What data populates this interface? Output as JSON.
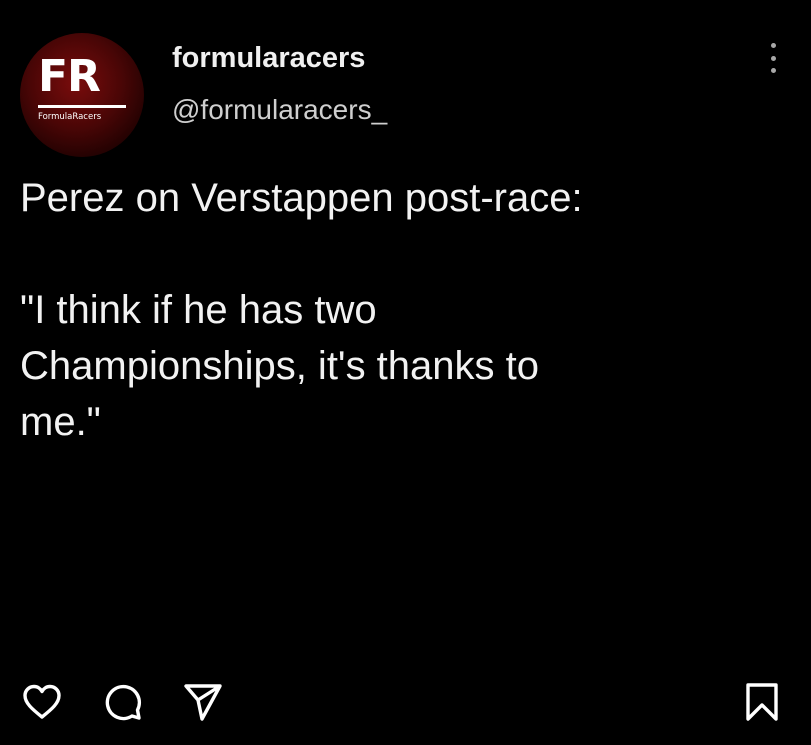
{
  "profile": {
    "avatar_logo": "FR",
    "avatar_subtext": "FormulaRacers",
    "username": "formularacers",
    "handle": "@formularacers_",
    "brand_color": "#6b0a0a"
  },
  "post": {
    "text": "Perez on Verstappen post-race:\n\n\"I think if he has two\nChampionships, it's thanks to\nme.\""
  },
  "actions": {
    "like_icon": "heart-icon",
    "comment_icon": "comment-icon",
    "share_icon": "send-icon",
    "save_icon": "bookmark-icon",
    "more_icon": "more-vertical-icon"
  }
}
